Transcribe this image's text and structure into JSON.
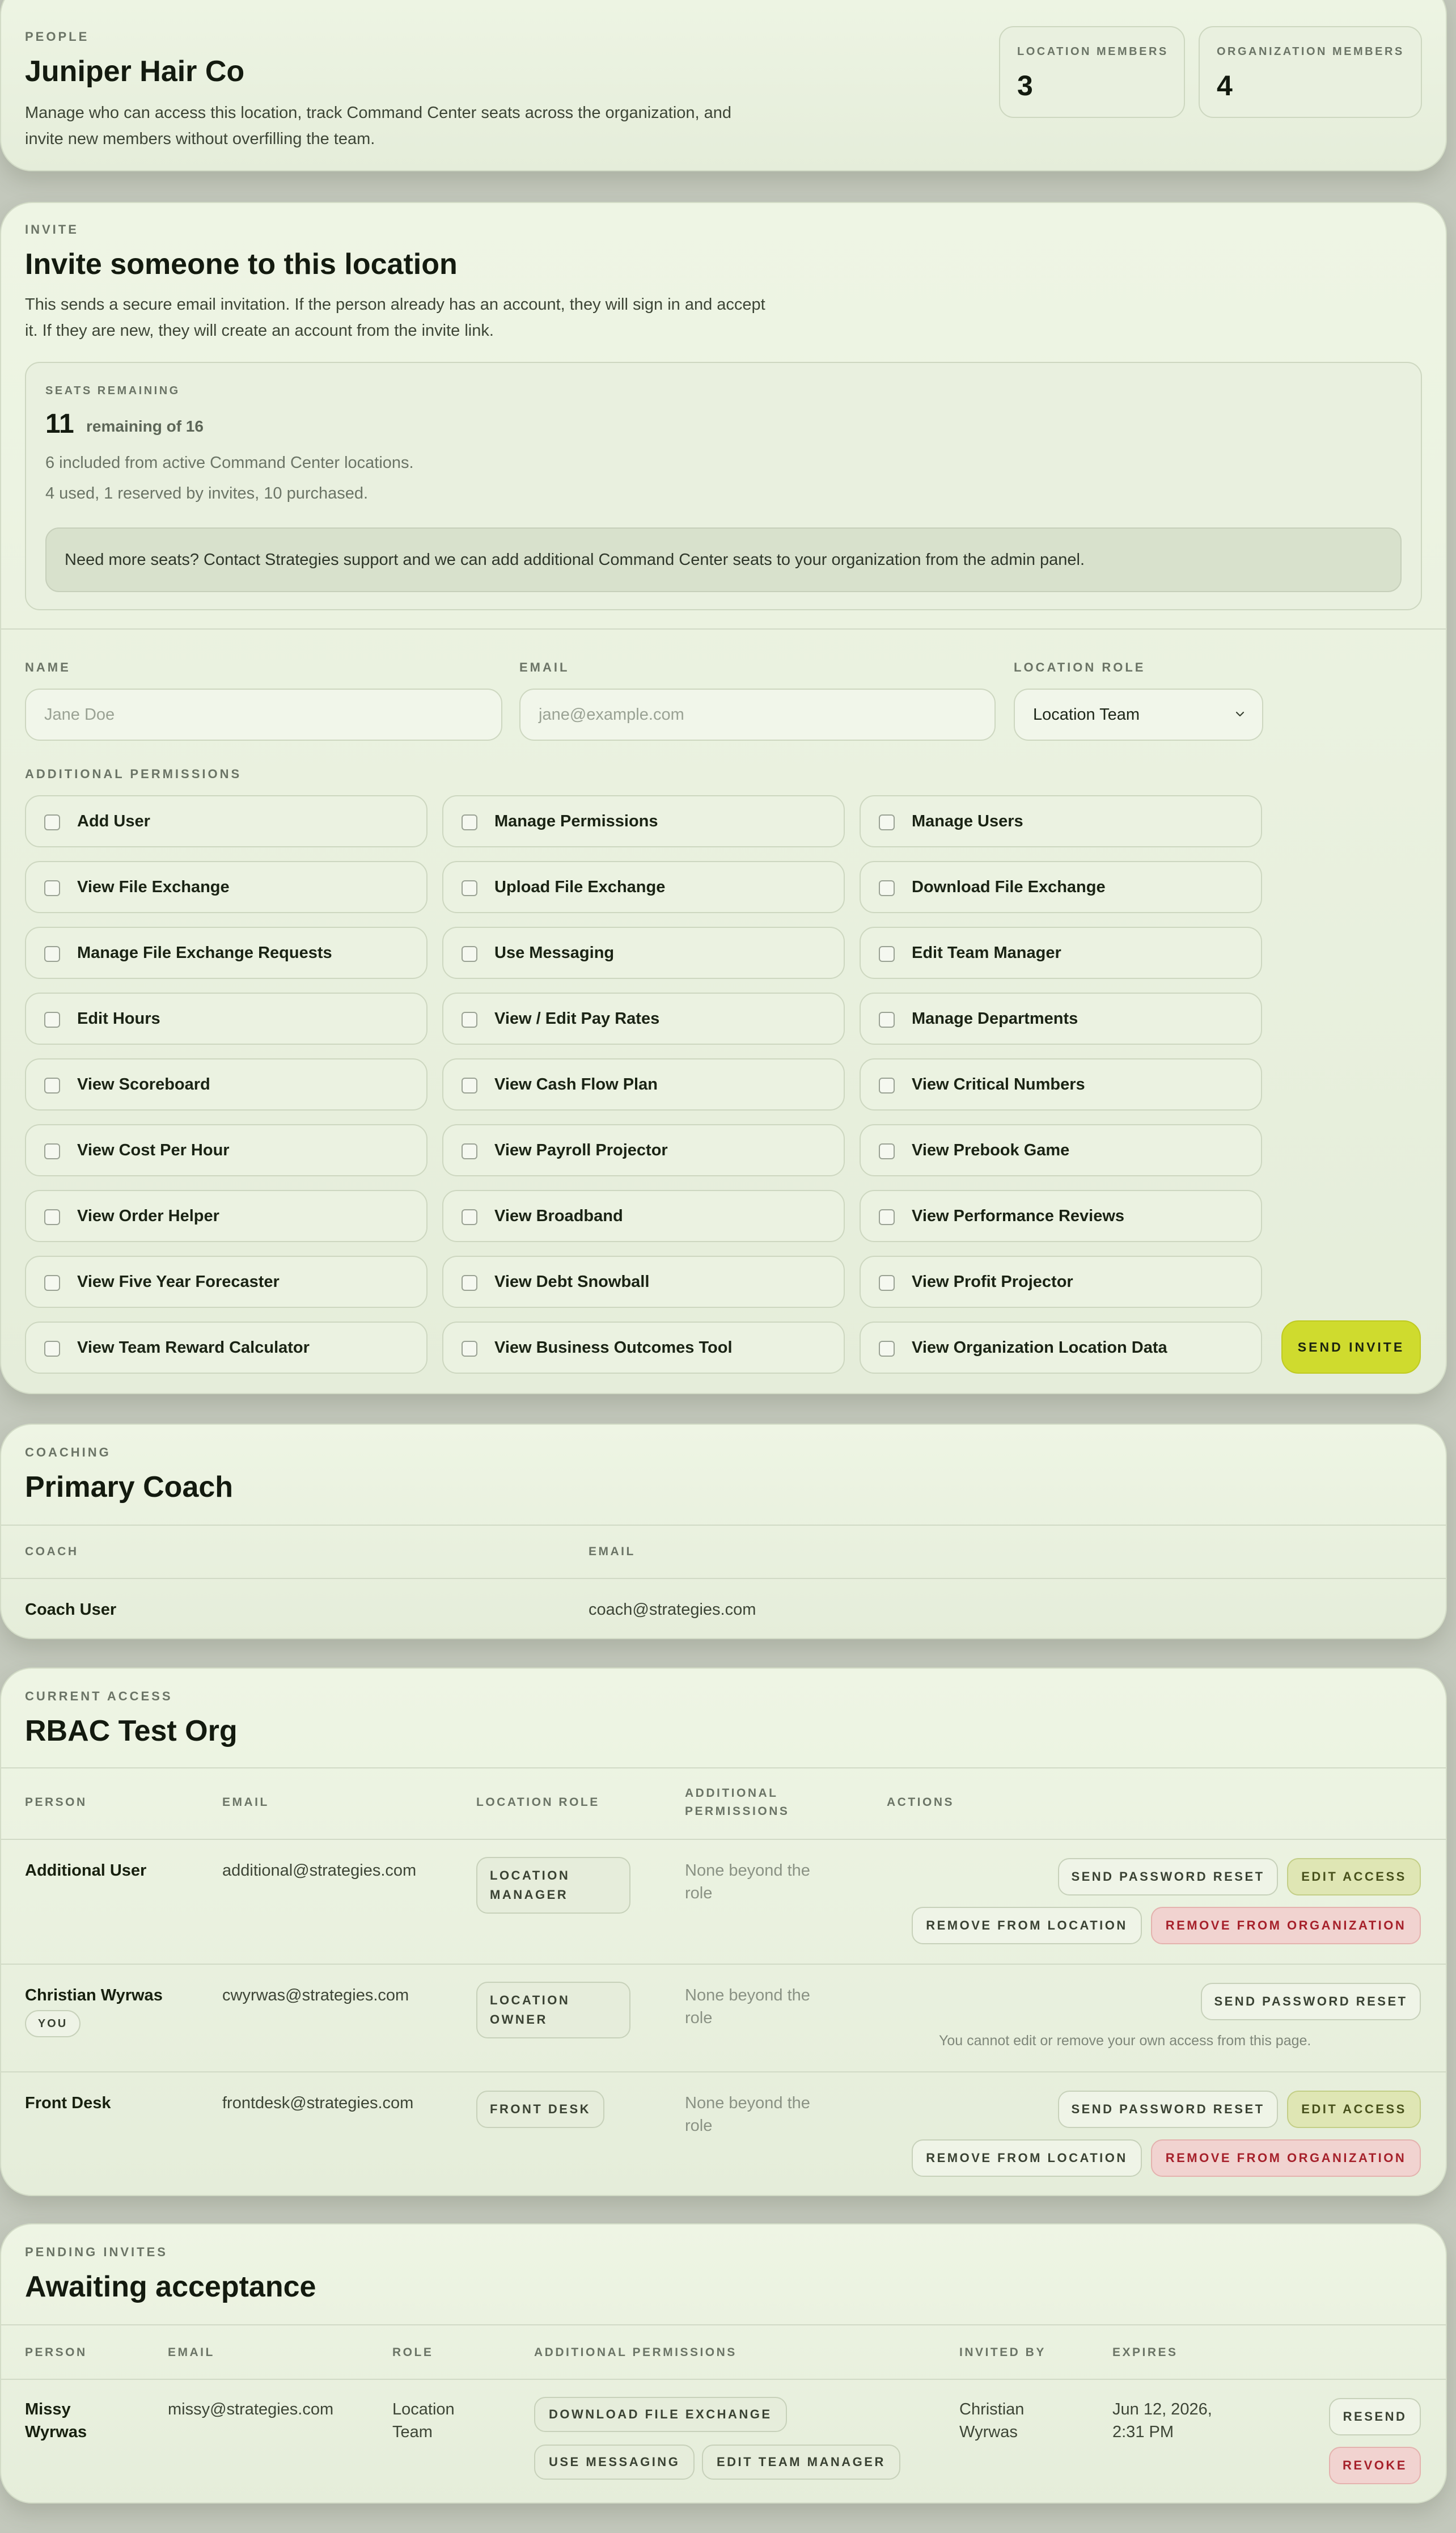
{
  "header": {
    "eyebrow": "PEOPLE",
    "title": "Juniper Hair Co",
    "description_line1": "Manage who can access this location, track Command Center seats across the organization, and",
    "description_line2": "invite new members without overfilling the team.",
    "location_members_label": "LOCATION MEMBERS",
    "location_members_value": "3",
    "organization_members_label": "ORGANIZATION MEMBERS",
    "organization_members_value": "4"
  },
  "invite": {
    "eyebrow": "INVITE",
    "title": "Invite someone to this location",
    "description_line1": "This sends a secure email invitation. If the person already has an account, they will sign in and accept",
    "description_line2": "it. If they are new, they will create an account from the invite link.",
    "seats": {
      "label": "SEATS REMAINING",
      "count": "11",
      "count_suffix": "remaining of 16",
      "line1": "6 included from active Command Center locations.",
      "line2": "4 used, 1 reserved by invites, 10 purchased.",
      "notice": "Need more seats? Contact Strategies support and we can add additional Command Center seats to your organization from the admin panel."
    },
    "name_label": "NAME",
    "name_placeholder": "Jane Doe",
    "email_label": "EMAIL",
    "email_placeholder": "jane@example.com",
    "role_label": "LOCATION ROLE",
    "role_value": "Location Team",
    "permissions_label": "ADDITIONAL PERMISSIONS",
    "permissions": [
      "Add User",
      "Manage Permissions",
      "Manage Users",
      "View File Exchange",
      "Upload File Exchange",
      "Download File Exchange",
      "Manage File Exchange Requests",
      "Use Messaging",
      "Edit Team Manager",
      "Edit Hours",
      "View / Edit Pay Rates",
      "Manage Departments",
      "View Scoreboard",
      "View Cash Flow Plan",
      "View Critical Numbers",
      "View Cost Per Hour",
      "View Payroll Projector",
      "View Prebook Game",
      "View Order Helper",
      "View Broadband",
      "View Performance Reviews",
      "View Five Year Forecaster",
      "View Debt Snowball",
      "View Profit Projector",
      "View Team Reward Calculator",
      "View Business Outcomes Tool",
      "View Organization Location Data"
    ],
    "send_label": "SEND INVITE"
  },
  "coaching": {
    "eyebrow": "COACHING",
    "title": "Primary Coach",
    "col_coach": "COACH",
    "col_email": "EMAIL",
    "coach_name": "Coach User",
    "coach_email": "coach@strategies.com"
  },
  "access": {
    "eyebrow": "CURRENT ACCESS",
    "title": "RBAC Test Org",
    "col_person": "PERSON",
    "col_email": "EMAIL",
    "col_role": "LOCATION ROLE",
    "col_perms_1": "ADDITIONAL",
    "col_perms_2": "PERMISSIONS",
    "col_actions": "ACTIONS",
    "you_badge": "YOU",
    "self_note": "You cannot edit or remove your own access from this page.",
    "none_1": "None beyond the",
    "none_2": "role",
    "btn_reset": "SEND PASSWORD RESET",
    "btn_edit": "EDIT ACCESS",
    "btn_remove_loc": "REMOVE FROM LOCATION",
    "btn_remove_org": "REMOVE FROM ORGANIZATION",
    "rows": [
      {
        "name": "Additional User",
        "email": "additional@strategies.com",
        "role_1": "LOCATION",
        "role_2": "MANAGER"
      },
      {
        "name": "Christian Wyrwas",
        "email": "cwyrwas@strategies.com",
        "role_1": "LOCATION",
        "role_2": "OWNER"
      },
      {
        "name": "Front Desk",
        "email": "frontdesk@strategies.com",
        "role_1": "FRONT DESK",
        "role_2": ""
      }
    ]
  },
  "pending": {
    "eyebrow": "PENDING INVITES",
    "title": "Awaiting acceptance",
    "col_person": "PERSON",
    "col_email": "EMAIL",
    "col_role": "ROLE",
    "col_perms": "ADDITIONAL PERMISSIONS",
    "col_invited": "INVITED BY",
    "col_expires": "EXPIRES",
    "row": {
      "name_1": "Missy",
      "name_2": "Wyrwas",
      "email": "missy@strategies.com",
      "role_1": "Location",
      "role_2": "Team",
      "perm_1": "DOWNLOAD FILE EXCHANGE",
      "perm_2": "USE MESSAGING",
      "perm_3": "EDIT TEAM MANAGER",
      "invited_1": "Christian",
      "invited_2": "Wyrwas",
      "expires_1": "Jun 12, 2026,",
      "expires_2": "2:31 PM"
    },
    "btn_resend": "RESEND",
    "btn_revoke": "REVOKE"
  }
}
